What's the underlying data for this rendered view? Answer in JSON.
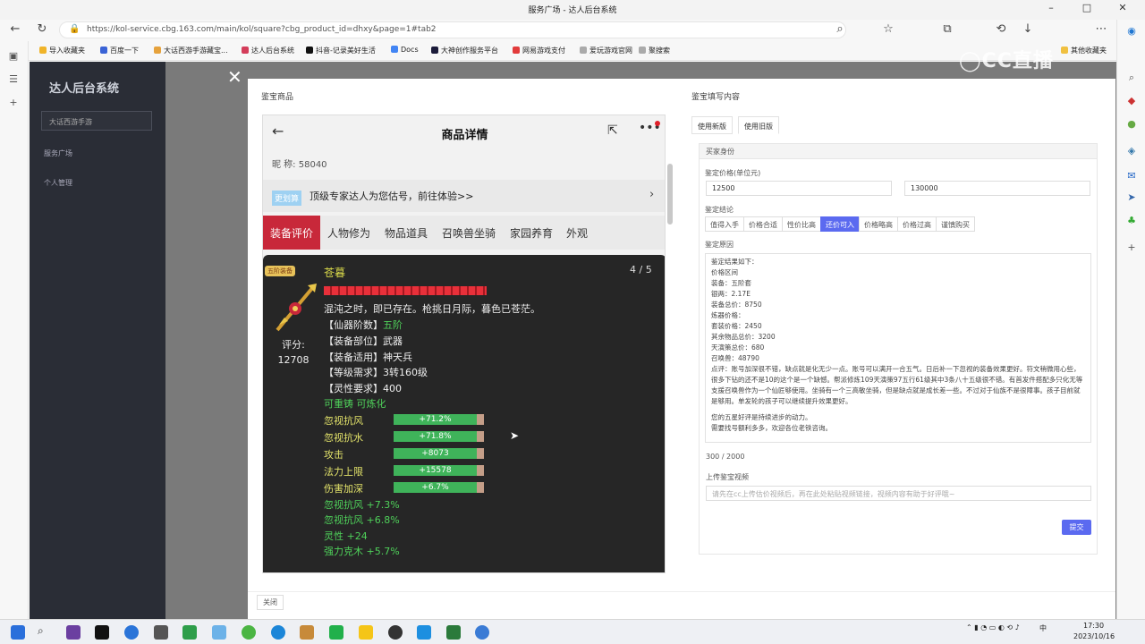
{
  "browser": {
    "tab_title": "服务广场 - 达人后台系统",
    "url": "https://kol-service.cbg.163.com/main/kol/square?cbg_product_id=dhxy&page=1#tab2",
    "bookmarks": [
      "导入收藏夹",
      "百度一下",
      "大话西游手游藏宝...",
      "达人后台系统",
      "抖音-记录美好生活",
      "Docs",
      "大神创作服务平台",
      "网易游戏支付",
      "爱玩游戏官网",
      "聚搜索"
    ],
    "bookmarks_right": "其他收藏夹"
  },
  "app": {
    "logo": "达人后台系统",
    "game_select": "大话西游手游",
    "menu": [
      "服务广场",
      "个人管理"
    ]
  },
  "dialog": {
    "left_title": "鉴宝商品",
    "right_title": "鉴宝填写内容",
    "close_label": "关闭"
  },
  "phone": {
    "header_title": "商品详情",
    "price_line": "昵 称: 58040",
    "banner_tag": "更划算",
    "banner_text": "顶级专家达人为您估号，前往体验>>",
    "tabs": [
      "装备评价",
      "人物修为",
      "物品道具",
      "召唤兽坐骑",
      "家园养育",
      "外观"
    ],
    "item": {
      "badge": "五阶装备",
      "name": "苍暮",
      "pager": "4 / 5",
      "desc": "混沌之时，即已存在。枪挑日月际，暮色已苍茫。",
      "score_label": "评分:",
      "score_value": "12708",
      "lines": [
        {
          "label": "【仙器阶数】",
          "value": "五阶"
        },
        {
          "label": "【装备部位】",
          "value": "武器"
        },
        {
          "label": "【装备适用】",
          "value": "神天兵"
        },
        {
          "label": "【等级需求】",
          "value": "3转160级"
        },
        {
          "label": "【灵性要求】",
          "value": "400"
        }
      ],
      "refine": "可重铸 可炼化",
      "attrs": [
        {
          "name": "忽视抗风",
          "value": "+71.2%"
        },
        {
          "name": "忽视抗水",
          "value": "+71.8%"
        },
        {
          "name": "攻击",
          "value": "+8073"
        },
        {
          "name": "法力上限",
          "value": "+15578"
        },
        {
          "name": "伤害加深",
          "value": "+6.7%"
        }
      ],
      "extras": [
        "忽视抗风 +7.3%",
        "忽视抗风 +6.8%",
        "灵性 +24",
        "强力克木 +5.7%"
      ]
    }
  },
  "form": {
    "tabs": [
      "使用新版",
      "使用旧版"
    ],
    "section": "买家身份",
    "price_label": "鉴定价格(单位元)",
    "price_min": "12500",
    "price_max": "130000",
    "conclusion_label": "鉴定结论",
    "conclusions": [
      "值得入手",
      "价格合适",
      "性价比高",
      "还价可入",
      "价格略高",
      "价格过高",
      "谨慎购买"
    ],
    "selected_conclusion": "还价可入",
    "reason_label": "鉴定原因",
    "reason_lines": [
      "鉴定结果如下：",
      "价格区间",
      "装备：五阶套",
      "银两：2.17E",
      "装备总价：8750",
      "炼器价格：",
      "套装价格：2450",
      "其余物品总价：3200",
      "天演策总价：680",
      "召唤兽：48790"
    ],
    "reason_comment": "点评：账号加深很不错，缺点就是化无少一点。账号可以满开一合五气。日后补一下忽视的装备效果更好。符文稍微用心些，很多下钻的还不是10的这个是一个缺憾。帮派修炼109天演策97五行61级其中3条八十五级很不错。有首发件搭配多只化无等支援召唤兽作为一个仙匠够使用。坐骑有一个三高敏坐骑，但是缺点就是成长差一些。不过对于仙族不是很障事。孩子目前就是够用。单发轮的孩子可以继续提升效果更好。",
    "reason_tail": [
      "您的五星好评是持续进步的动力。",
      "需要找号额利多多，欢迎各位老铁咨询。"
    ],
    "char_count": "300 / 2000",
    "video_label": "上传鉴宝视频",
    "video_placeholder": "请先在cc上传估价视频后，再在此处粘贴视频链接，视频内容有助于好评哦~",
    "submit": "提交"
  },
  "taskbar": {
    "time": "17:30",
    "date": "2023/10/16",
    "lang": "中"
  }
}
